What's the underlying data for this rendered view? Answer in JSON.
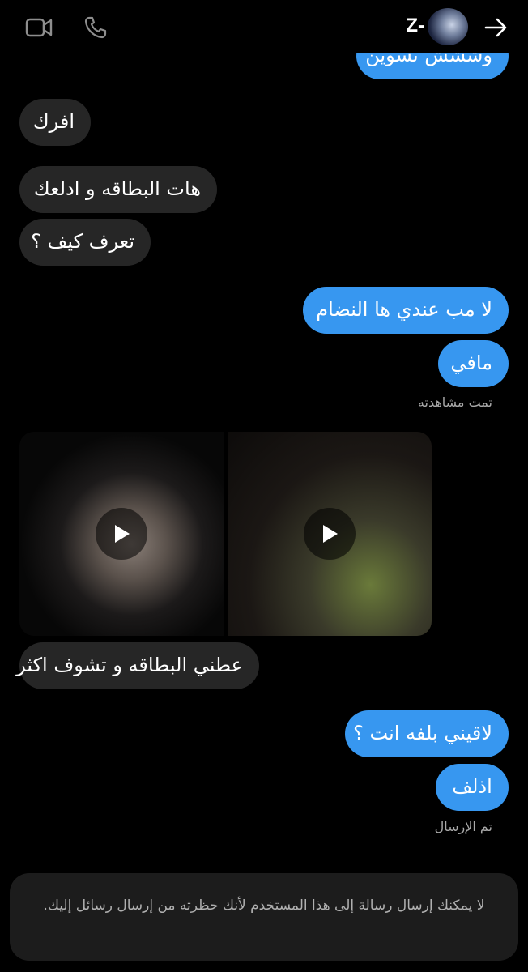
{
  "header": {
    "name": "Z-",
    "icons": {
      "video": "video-camera-icon",
      "phone": "phone-icon",
      "back": "arrow-right-icon"
    }
  },
  "messages": {
    "top_partial": "وششش تسوين",
    "m1": "افرك",
    "m2": "هات البطاقه و ادلعك",
    "m3": "تعرف كيف ؟",
    "m4": "لا مب عندي ها النضام",
    "m5": "مافي",
    "seen": "تمت مشاهدته",
    "m6": "عطني البطاقه و تشوف اكثر",
    "m7": "لاقيني بلفه انت ؟",
    "m8": "اذلف",
    "sent": "تم الإرسال"
  },
  "media": {
    "items": [
      {
        "type": "video",
        "icon": "play-icon"
      },
      {
        "type": "video",
        "icon": "play-icon"
      }
    ]
  },
  "banner": {
    "text": "لا يمكنك إرسال رسالة إلى هذا المستخدم لأنك حظرته من إرسال رسائل إليك."
  },
  "colors": {
    "outgoing": "#3797f0",
    "incoming": "#262626",
    "background": "#000000"
  }
}
